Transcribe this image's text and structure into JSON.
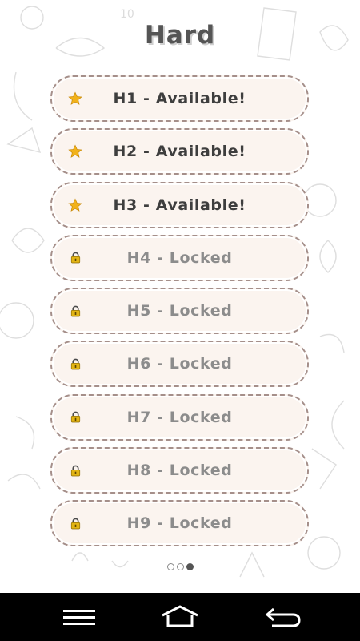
{
  "header": {
    "title": "Hard"
  },
  "levels": [
    {
      "label": "H1 - Available!",
      "state": "available",
      "icon": "star-icon"
    },
    {
      "label": "H2 - Available!",
      "state": "available",
      "icon": "star-icon"
    },
    {
      "label": "H3 - Available!",
      "state": "available",
      "icon": "star-icon"
    },
    {
      "label": "H4 - Locked",
      "state": "locked",
      "icon": "lock-icon"
    },
    {
      "label": "H5 - Locked",
      "state": "locked",
      "icon": "lock-icon"
    },
    {
      "label": "H6 - Locked",
      "state": "locked",
      "icon": "lock-icon"
    },
    {
      "label": "H7 - Locked",
      "state": "locked",
      "icon": "lock-icon"
    },
    {
      "label": "H8 - Locked",
      "state": "locked",
      "icon": "lock-icon"
    },
    {
      "label": "H9 - Locked",
      "state": "locked",
      "icon": "lock-icon"
    }
  ],
  "pager": {
    "pages": 3,
    "current": 3
  },
  "navbar": {
    "buttons": [
      "menu-icon",
      "home-icon",
      "back-icon"
    ]
  },
  "colors": {
    "button_bg": "#fbf4ef",
    "button_border": "#a58f8a",
    "available_text": "#3e3e3e",
    "locked_text": "#8c8c8c",
    "star": "#f2b21a",
    "lock": "#e3b514"
  }
}
